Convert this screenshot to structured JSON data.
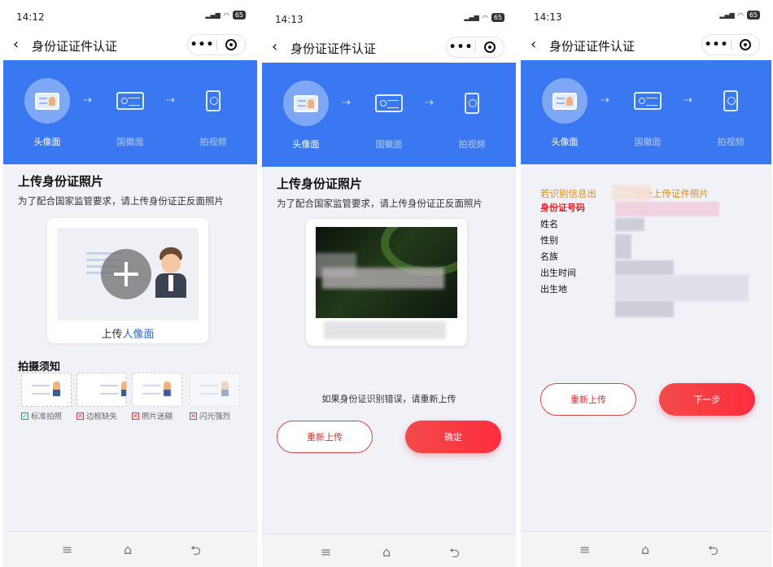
{
  "screens": [
    {
      "time": "14:12",
      "battery": "65",
      "nav_title": "身份证证件认证",
      "steps": [
        "头像面",
        "国徽面",
        "拍视频"
      ],
      "section_title": "上传身份证照片",
      "section_desc": "为了配合国家监管要求，请上传身份证正反面照片",
      "upload_label_prefix": "上传",
      "upload_label_highlight": "人像面",
      "tips_title": "拍摄须知",
      "tips": [
        {
          "label": "标准拍照",
          "status": "ok"
        },
        {
          "label": "边框缺失",
          "status": "bad"
        },
        {
          "label": "照片迷糊",
          "status": "bad"
        },
        {
          "label": "闪光强烈",
          "status": "bad"
        }
      ]
    },
    {
      "time": "14:13",
      "battery": "65",
      "nav_title": "身份证证件认证",
      "steps": [
        "头像面",
        "国徽面",
        "拍视频"
      ],
      "section_title": "上传身份证照片",
      "section_desc": "为了配合国家监管要求，请上传身份证正反面照片",
      "hint": "如果身份证识别错误，请重新上传",
      "reupload_label": "重新上传",
      "confirm_label": "确定"
    },
    {
      "time": "14:13",
      "battery": "65",
      "nav_title": "身份证证件认证",
      "steps": [
        "头像面",
        "国徽面",
        "拍视频"
      ],
      "warning_left": "若识别信息出",
      "warning_right": "重新上传证件照片",
      "fields": [
        {
          "label": "身份证号码",
          "required": true
        },
        {
          "label": "姓名",
          "required": false
        },
        {
          "label": "性别",
          "required": false
        },
        {
          "label": "名族",
          "required": false
        },
        {
          "label": "出生时间",
          "required": false
        },
        {
          "label": "出生地",
          "required": false
        }
      ],
      "reupload_label": "重新上传",
      "next_label": "下一步"
    }
  ],
  "colors": {
    "primary_blue": "#3a78f2",
    "accent_red": "#f2333f",
    "warning_orange": "#e48a1e"
  },
  "icons": {
    "back": "back-arrow-icon",
    "more": "more-dots-icon",
    "record": "record-icon"
  }
}
